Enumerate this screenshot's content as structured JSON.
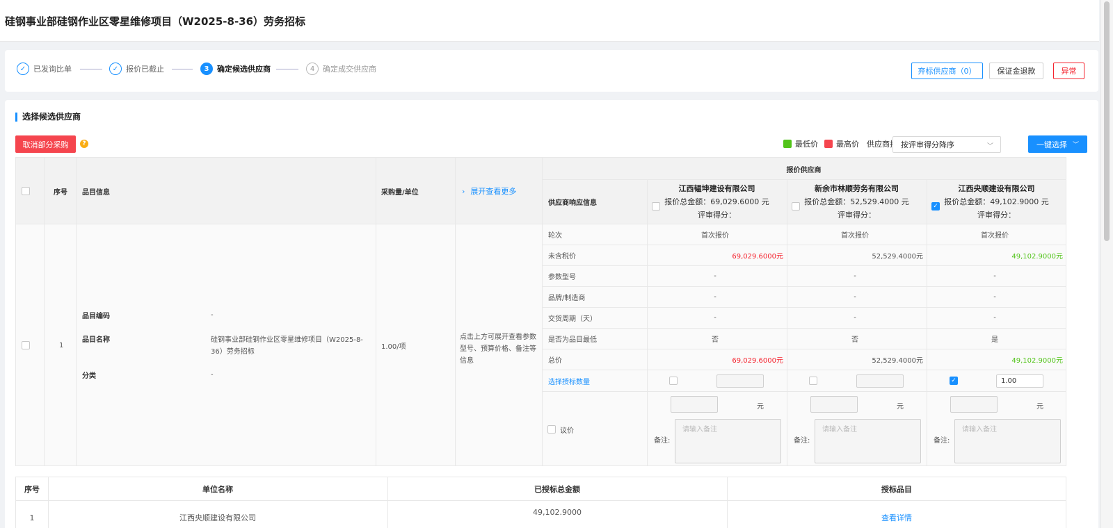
{
  "header": {
    "breadcrumb": "",
    "title": "硅钢事业部硅钢作业区零星维修项目（W2025-8-36）劳务招标"
  },
  "steps": [
    {
      "index": "✓",
      "label": "已发询比单",
      "state": "done"
    },
    {
      "index": "✓",
      "label": "报价已截止",
      "state": "done"
    },
    {
      "index": "3",
      "label": "确定候选供应商",
      "state": "active"
    },
    {
      "index": "4",
      "label": "确定成交供应商",
      "state": "pending"
    }
  ],
  "actions": {
    "abandon_label": "弃标供应商（0）",
    "deposit_label": "保证金退款",
    "abnormal_label": "异常"
  },
  "section": {
    "title": "选择候选供应商",
    "cancel_label": "取消部分采购",
    "help": "?",
    "legend_low": "最低价",
    "legend_high": "最高价",
    "legend_low_color": "#52c41a",
    "legend_high_color": "#f5454e",
    "sort_label": "供应商排序",
    "sort_value": "按评审得分降序",
    "one_click_label": "一键选择"
  },
  "table": {
    "headers": {
      "index": "序号",
      "item_info": "品目信息",
      "quantity": "采购量/单位",
      "expand": "展开查看更多",
      "suppliers_group": "报价供应商",
      "supplier_response": "供应商响应信息"
    },
    "suppliers": [
      {
        "name": "江西韫坤建设有限公司",
        "total": "报价总金额：69,029.6000 元",
        "score": "评审得分：",
        "checked": false
      },
      {
        "name": "新余市林顺劳务有限公司",
        "total": "报价总金额：52,529.4000 元",
        "score": "评审得分：",
        "checked": true
      },
      {
        "name": "江西央顺建设有限公司",
        "total": "报价总金额：49,102.9000 元",
        "score": "评审得分：",
        "checked": true
      }
    ],
    "row": {
      "index": "1",
      "code_label": "品目编码",
      "code_value": "-",
      "name_label": "品目名称",
      "name_value": "硅钢事业部硅钢作业区零星维修项目（W2025-8-36）劳务招标",
      "category_label": "分类",
      "category_value": "-",
      "quantity": "1.00/项",
      "expand_hint": "点击上方可展开查看参数型号、预算价格、备注等信息"
    },
    "attributes": [
      {
        "label": "轮次",
        "values": [
          "首次报价",
          "首次报价",
          "首次报价"
        ]
      },
      {
        "label": "未含税价",
        "values": [
          "69,029.6000元",
          "52,529.4000元",
          "49,102.9000元"
        ]
      },
      {
        "label": "参数型号",
        "values": [
          "-",
          "-",
          "-"
        ]
      },
      {
        "label": "品牌/制造商",
        "values": [
          "-",
          "-",
          "-"
        ]
      },
      {
        "label": "交货周期（天）",
        "values": [
          "-",
          "-",
          "-"
        ]
      },
      {
        "label": "是否为品目最低",
        "values": [
          "否",
          "否",
          "是"
        ]
      },
      {
        "label": "总价",
        "values": [
          "69,029.6000元",
          "52,529.4000元",
          "49,102.9000元"
        ]
      }
    ],
    "select_quantity_label": "选择授标数量",
    "select_quantity_values": [
      "",
      "",
      "1.00"
    ],
    "negotiate_label": "议价",
    "yuan": "元",
    "remark_label": "备注:",
    "remark_placeholder": "请输入备注"
  },
  "bottom_table": {
    "headers": [
      "序号",
      "单位名称",
      "已授标总金额",
      "授标品目"
    ],
    "rows": [
      {
        "index": "1",
        "company": "江西央顺建设有限公司",
        "amount": "49,102.9000",
        "action": "查看详情"
      }
    ]
  }
}
